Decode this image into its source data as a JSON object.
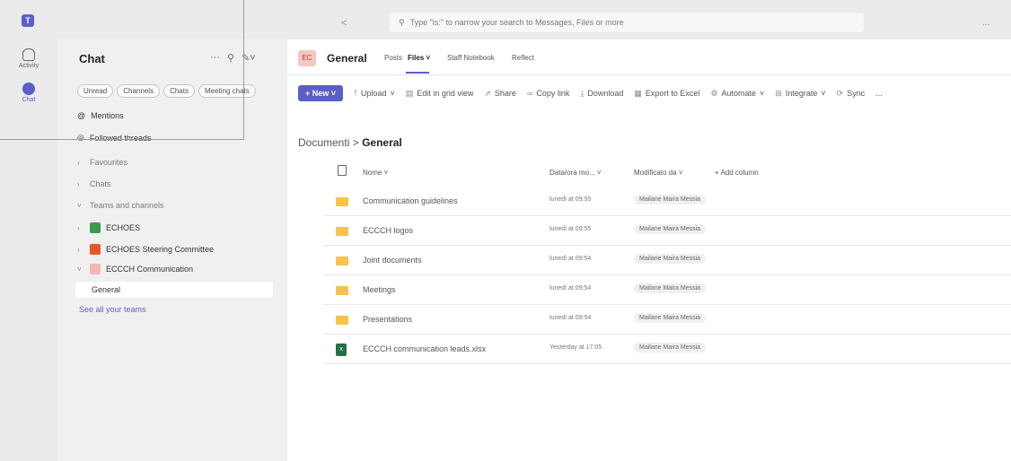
{
  "titlebar": {
    "back": "<",
    "search_placeholder": "Type \"is:\" to narrow your search to Messages, Files or more",
    "more": "..."
  },
  "rail": {
    "items": [
      {
        "label": "Activity",
        "icon": "bell-icon"
      },
      {
        "label": "Chat",
        "icon": "chat-icon"
      }
    ]
  },
  "chat": {
    "title": "Chat",
    "filters": [
      "Unread",
      "Channels",
      "Chats",
      "Meeting chats"
    ],
    "mentions": "Mentions",
    "followed": "Followed threads",
    "favourites": "Favourites",
    "chats": "Chats",
    "teams_and_channels": "Teams and channels",
    "teams": [
      {
        "name": "ECHOES",
        "color": "#3a9a4b"
      },
      {
        "name": "ECHOES Steering Committee",
        "color": "#e8542b"
      },
      {
        "name": "ECCCH Communication",
        "color": "#f4b8b0"
      }
    ],
    "general": "General",
    "see_all": "See all your teams"
  },
  "main": {
    "channel_avatar": "EC",
    "channel_name": "General",
    "tabs": [
      "Posts",
      "Files",
      "Staff Notebook",
      "Reflect"
    ],
    "active_tab": "Files",
    "commands": {
      "new": "+ New",
      "upload": "Upload",
      "edit_grid": "Edit in grid view",
      "share": "Share",
      "copy_link": "Copy link",
      "download": "Download",
      "export": "Export to Excel",
      "automate": "Automate",
      "integrate": "Integrate",
      "sync": "Sync",
      "more": "..."
    },
    "breadcrumb": {
      "root": "Documenti",
      "sep": ">",
      "current": "General"
    },
    "columns": {
      "name": "Nome",
      "modified": "Data/ora mo...",
      "modified_by": "Modificato da",
      "add": "+ Add column"
    },
    "files": [
      {
        "name": "Communication guidelines",
        "date": "lunedì at 09:55",
        "by": "Mailane Maira Messia",
        "type": "folder"
      },
      {
        "name": "ECCCH logos",
        "date": "lunedì at 09:55",
        "by": "Mailane Maira Messia",
        "type": "folder"
      },
      {
        "name": "Joint documents",
        "date": "lunedì at 09:54",
        "by": "Mailane Maira Messia",
        "type": "folder"
      },
      {
        "name": "Meetings",
        "date": "lunedì at 09:54",
        "by": "Mailane Maira Messia",
        "type": "folder"
      },
      {
        "name": "Presentations",
        "date": "lunedì at 09:54",
        "by": "Mailane Maira Messia",
        "type": "folder"
      },
      {
        "name": "ECCCH communication leads.xlsx",
        "date": "Yesterday at 17:05",
        "by": "Mailane Maira Messia",
        "type": "xlsx"
      }
    ]
  },
  "colors": {
    "accent": "#5b5fc7",
    "folder": "#f7c34b",
    "excel": "#1f7244"
  }
}
